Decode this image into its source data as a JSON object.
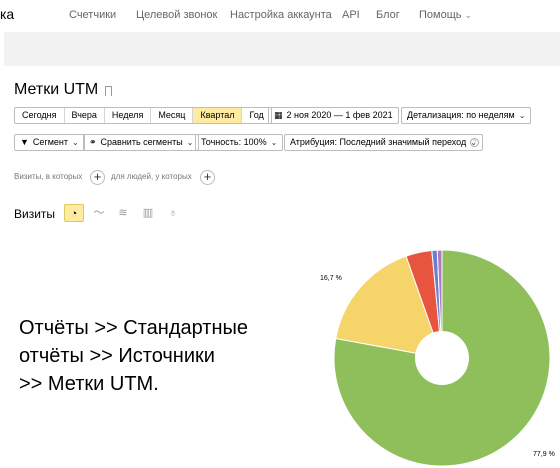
{
  "topnav": {
    "logo_fragment": "ка",
    "links": [
      "Счетчики",
      "Целевой звонок",
      "Настройка аккаунта",
      "API",
      "Блог",
      "Помощь"
    ]
  },
  "page": {
    "title": "Метки UTM"
  },
  "period": {
    "buttons": [
      "Сегодня",
      "Вчера",
      "Неделя",
      "Месяц",
      "Квартал",
      "Год"
    ],
    "active": "Квартал",
    "date_range": "2 ноя 2020 — 1 фев 2021",
    "detail": "Детализация: по неделям"
  },
  "filters": {
    "segment": "Сегмент",
    "compare": "Сравнить сегменты",
    "accuracy": "Точность: 100%",
    "attribution": "Атрибуция: Последний значимый переход"
  },
  "visits_filter": {
    "visits_which": "Визиты, в которых",
    "for_people": "для людей, у которых"
  },
  "chart_section": {
    "label": "Визиты",
    "types": [
      "pie-icon",
      "line-icon",
      "area-icon",
      "bar-icon",
      "map-pin-icon"
    ],
    "active_type": "pie-icon"
  },
  "overlay": {
    "line1": "Отчёты >> Стандартные",
    "line2": "отчёты >> Источники",
    "line3": ">> Метки UTM."
  },
  "chart_data": {
    "type": "pie",
    "donut": true,
    "slices": [
      {
        "value": 77.9,
        "label": "77,9 %",
        "color": "#8fbf5a"
      },
      {
        "value": 16.7,
        "label": "16,7 %",
        "color": "#f5d46a"
      },
      {
        "value": 3.9,
        "label": "",
        "color": "#e8553f"
      },
      {
        "value": 0.8,
        "label": "",
        "color": "#6a7fd0"
      },
      {
        "value": 0.7,
        "label": "",
        "color": "#b079c4"
      }
    ]
  }
}
